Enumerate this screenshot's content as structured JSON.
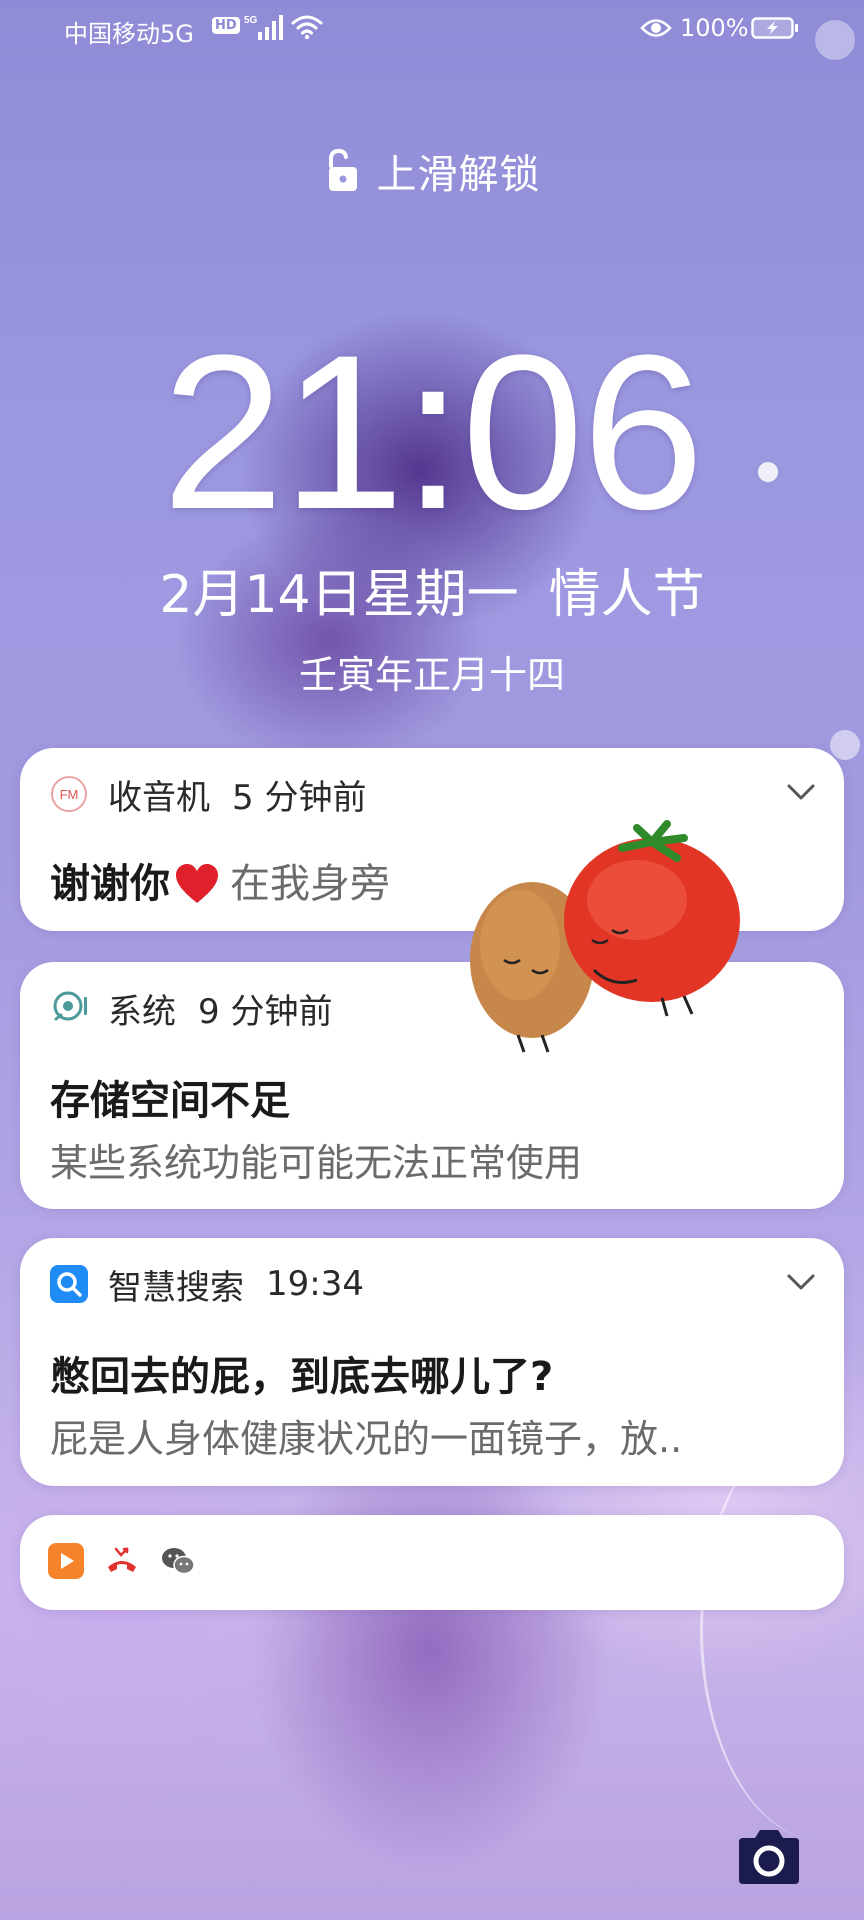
{
  "status_bar": {
    "carrier": "中国移动5G",
    "hd_badge": "HD",
    "network": "5G",
    "battery_percent": "100%",
    "icons": [
      "signal-icon",
      "wifi-icon",
      "eye-icon",
      "battery-charging-icon"
    ]
  },
  "lockscreen": {
    "unlock_hint": "上滑解锁",
    "time": "21:06",
    "date": "2月14日星期一",
    "holiday": "情人节",
    "lunar_date": "壬寅年正月十四"
  },
  "notifications": [
    {
      "app_name": "收音机",
      "time": "5 分钟前",
      "title": "谢谢你",
      "title_rest": "在我身旁",
      "icon": "fm-radio-icon",
      "expandable": true
    },
    {
      "app_name": "系统",
      "time": "9 分钟前",
      "title": "存储空间不足",
      "body": "某些系统功能可能无法正常使用",
      "icon": "system-icon",
      "expandable": false
    },
    {
      "app_name": "智慧搜索",
      "time": "19:34",
      "title": "憋回去的屁，到底去哪儿了?",
      "body": "屁是人身体健康状况的一面镜子，放..",
      "icon": "search-app-icon",
      "expandable": true
    }
  ],
  "more_notifications": {
    "icons": [
      "video-app-icon",
      "missed-call-icon",
      "wechat-icon"
    ]
  },
  "colors": {
    "card_bg": "#ffffff",
    "accent_blue": "#1f8cf5",
    "heart_red": "#e0202a",
    "camera_dark": "#1b1b4d"
  }
}
